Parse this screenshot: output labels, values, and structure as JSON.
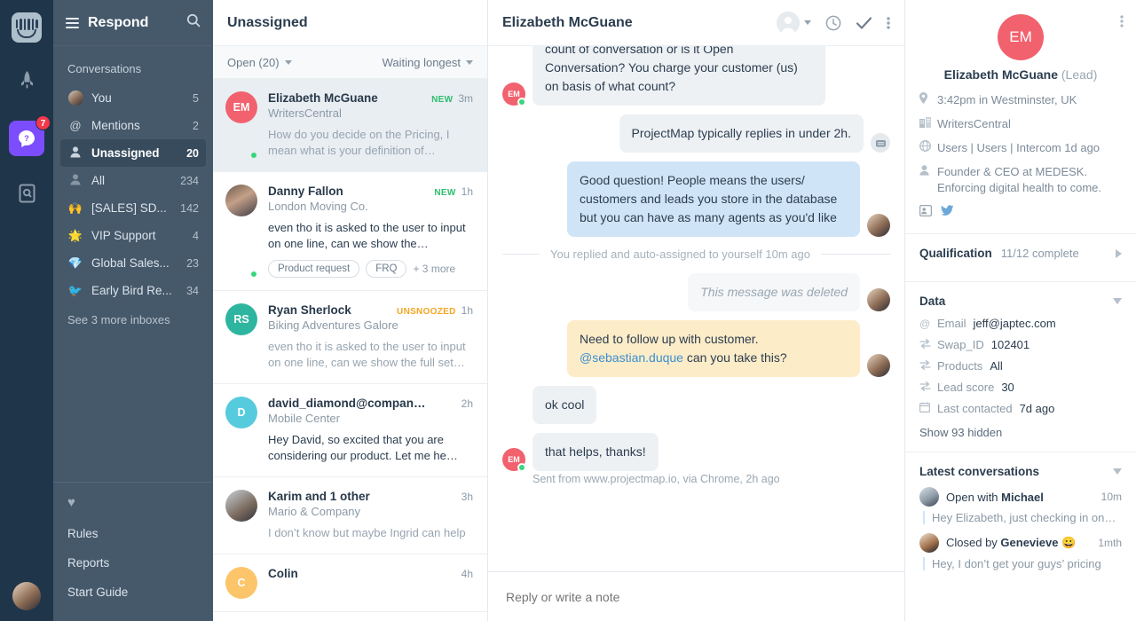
{
  "rail": {
    "logo_name": "intercom-logo",
    "items": [
      {
        "name": "rocket-icon",
        "badge": ""
      },
      {
        "name": "messenger-icon",
        "badge": "7"
      },
      {
        "name": "articles-search-icon",
        "badge": ""
      }
    ]
  },
  "sidebar": {
    "title": "Respond",
    "menu_icon": "hamburger-icon",
    "search_icon": "search-icon",
    "section_label": "Conversations",
    "items": [
      {
        "label": "You",
        "count": "5",
        "icon": "avatar",
        "active": false
      },
      {
        "label": "Mentions",
        "count": "2",
        "icon": "at-sign",
        "active": false
      },
      {
        "label": "Unassigned",
        "count": "20",
        "icon": "person",
        "active": true
      },
      {
        "label": "All",
        "count": "234",
        "icon": "person",
        "active": false
      },
      {
        "label": "[SALES] SD...",
        "count": "142",
        "icon": "🙌",
        "active": false
      },
      {
        "label": "VIP Support",
        "count": "4",
        "icon": "🌟",
        "active": false
      },
      {
        "label": "Global Sales...",
        "count": "23",
        "icon": "💎",
        "active": false
      },
      {
        "label": "Early Bird Re...",
        "count": "34",
        "icon": "🐦",
        "active": false
      }
    ],
    "see_more": "See 3 more inboxes",
    "heart_icon": "heart-icon",
    "footer_items": [
      {
        "label": "Rules"
      },
      {
        "label": "Reports"
      },
      {
        "label": "Start Guide"
      }
    ]
  },
  "list": {
    "title": "Unassigned",
    "status_filter": "Open (20)",
    "sort_filter": "Waiting longest",
    "conversations": [
      {
        "initials": "EM",
        "avatar_color": "#f2616e",
        "photo": "",
        "name": "Elizabeth McGuane",
        "company": "WritersCentral",
        "tag": "NEW",
        "tag_type": "new",
        "time": "3m",
        "preview": "How do you decide on the Pricing, I mean what is your definition of…",
        "unread": false,
        "online": true,
        "selected": true,
        "tags": []
      },
      {
        "initials": "DF",
        "avatar_color": "#5b7ea8",
        "photo": "photo-a",
        "name": "Danny Fallon",
        "company": "London Moving Co.",
        "tag": "NEW",
        "tag_type": "new",
        "time": "1h",
        "preview": "even tho it is asked to the user to input on one line, can we show the…",
        "unread": true,
        "online": true,
        "selected": false,
        "tags": [
          "Product request",
          "FRQ"
        ],
        "more_tags": "+ 3 more"
      },
      {
        "initials": "RS",
        "avatar_color": "#2eb5a0",
        "photo": "",
        "name": "Ryan Sherlock",
        "company": "Biking Adventures Galore",
        "tag": "UNSNOOZED",
        "tag_type": "unsnoozed",
        "time": "1h",
        "preview": "even tho it is asked to the user to input on one line, can we show the full set…",
        "unread": false,
        "online": false,
        "selected": false,
        "tags": []
      },
      {
        "initials": "D",
        "avatar_color": "#56cbdd",
        "photo": "",
        "name": "david_diamond@compan…",
        "company": "Mobile Center",
        "tag": "",
        "tag_type": "",
        "time": "2h",
        "preview": "Hey David, so excited that you are considering our product. Let me he…",
        "unread": true,
        "online": false,
        "selected": false,
        "tags": []
      },
      {
        "initials": "K",
        "avatar_color": "#8a7d6b",
        "photo": "photo-d",
        "name": "Karim and 1 other",
        "company": "Mario & Company",
        "tag": "",
        "tag_type": "",
        "time": "3h",
        "preview": "I don’t know but maybe Ingrid can help",
        "unread": false,
        "online": false,
        "selected": false,
        "tags": []
      },
      {
        "initials": "C",
        "avatar_color": "#fcc56a",
        "photo": "",
        "name": "Colin",
        "company": "",
        "tag": "",
        "tag_type": "",
        "time": "4h",
        "preview": "",
        "unread": false,
        "online": false,
        "selected": false,
        "tags": []
      }
    ]
  },
  "thread": {
    "title": "Elizabeth McGuane",
    "actions": [
      {
        "name": "assignee-selector",
        "icon": "avatar-chevron"
      },
      {
        "name": "snooze-button",
        "icon": "clock-icon"
      },
      {
        "name": "close-conversation-button",
        "icon": "check-icon"
      },
      {
        "name": "more-options-button",
        "icon": "vertical-dots-icon"
      }
    ],
    "messages": [
      {
        "kind": "in",
        "author_initials": "EM",
        "avatar_color": "#f2616e",
        "text": "count of conversation or is it Open Conversation? You charge your customer (us) on basis of what count?"
      },
      {
        "kind": "bot",
        "text": "ProjectMap typically replies in under 2h.",
        "bot_icon": "messenger-icon"
      },
      {
        "kind": "out",
        "text": "Good question! People means the users/ customers and leads you store in the database but you can have as many agents as you'd like",
        "photo": "photo-c"
      },
      {
        "kind": "divider",
        "text": "You replied and auto-assigned to yourself 10m ago"
      },
      {
        "kind": "deleted",
        "text": "This message was deleted",
        "photo": "photo-c"
      },
      {
        "kind": "note",
        "text": "Need to follow up with customer. ",
        "mention": "@sebastian.duque",
        "text_after": " can you take this?",
        "photo": "photo-c"
      },
      {
        "kind": "in",
        "text": "ok cool",
        "author_initials": "",
        "avatar_color": "#f2616e",
        "no_avatar": true
      },
      {
        "kind": "in",
        "text": "that helps, thanks!",
        "author_initials": "EM",
        "avatar_color": "#f2616e"
      }
    ],
    "sent_from": "Sent from www.projectmap.io, via Chrome, 2h ago",
    "composer_placeholder": "Reply or write a note"
  },
  "panel": {
    "more_icon": "vertical-dots-icon",
    "avatar_initials": "EM",
    "avatar_color": "#f2616e",
    "name": "Elizabeth McGuane",
    "role": "(Lead)",
    "attributes": [
      {
        "icon": "location-pin-icon",
        "text": "3:42pm in Westminster, UK"
      },
      {
        "icon": "building-icon",
        "text": "WritersCentral"
      },
      {
        "icon": "globe-icon",
        "text": "Users | Users | Intercom 1d ago"
      },
      {
        "icon": "person-icon",
        "text": "Founder & CEO at MEDESK. Enforcing digital health to come."
      }
    ],
    "socials": [
      {
        "icon": "contact-card-icon"
      },
      {
        "icon": "twitter-icon"
      }
    ],
    "qualification": {
      "title": "Qualification",
      "progress": "11/12 complete",
      "toggle_icon": "triangle-right-icon"
    },
    "data": {
      "title": "Data",
      "toggle_icon": "triangle-down-icon",
      "rows": [
        {
          "icon": "at-sign-icon",
          "key": "Email",
          "value": "jeff@japtec.com"
        },
        {
          "icon": "swap-icon",
          "key": "Swap_ID",
          "value": "102401"
        },
        {
          "icon": "swap-icon",
          "key": "Products",
          "value": "All"
        },
        {
          "icon": "swap-icon",
          "key": "Lead score",
          "value": "30"
        },
        {
          "icon": "calendar-icon",
          "key": "Last contacted",
          "value": "7d ago"
        }
      ],
      "show_hidden": "Show 93 hidden"
    },
    "latest": {
      "title": "Latest conversations",
      "toggle_icon": "triangle-down-icon",
      "items": [
        {
          "prefix": "Open with ",
          "who": "Michael",
          "emoji": "",
          "time": "10m",
          "preview": "Hey Elizabeth, just checking in on…",
          "photo": "photo-e"
        },
        {
          "prefix": "Closed by ",
          "who": "Genevieve",
          "emoji": "😀",
          "time": "1mth",
          "preview": "Hey, I don’t get your guys’ pricing",
          "photo": "photo-f"
        }
      ]
    }
  }
}
